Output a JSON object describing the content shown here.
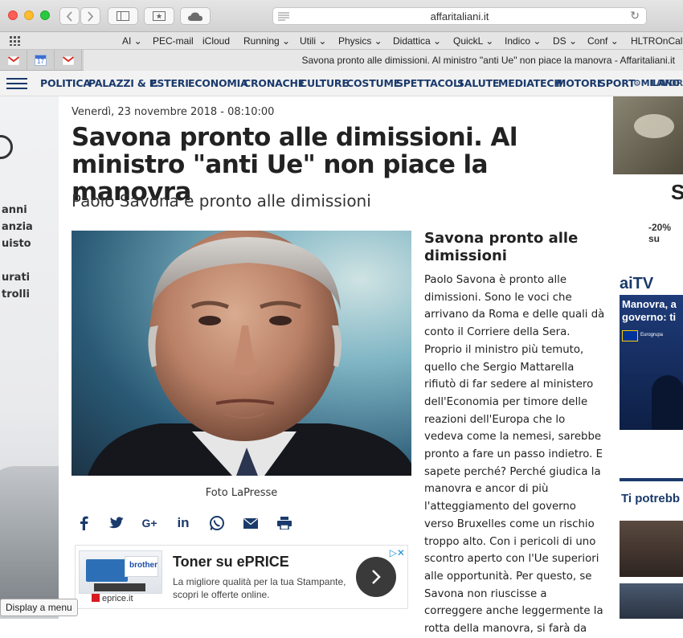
{
  "browser": {
    "url": "affaritaliani.it",
    "bookmarks": [
      "AI",
      "PEC-mail",
      "iCloud",
      "Running",
      "Utili",
      "Physics",
      "Didattica",
      "QuickL",
      "Indico",
      "DS",
      "Conf",
      "HLTROnCall_"
    ],
    "pinned_tabs": [
      "gmail-icon",
      "calendar-icon",
      "gmail-icon"
    ],
    "calendar_day": "17",
    "active_tab_title": "Savona pronto alle dimissioni. Al ministro \"anti Ue\" non piace la manovra - Affaritaliani.it"
  },
  "site_nav": {
    "items": [
      "POLITICA",
      "PALAZZI & P.",
      "ESTERI",
      "ECONOMIA",
      "CRONACHE",
      "CULTURE",
      "COSTUME",
      "SPETTACOLI",
      "SALUTE",
      "MEDIATECH",
      "MOTORI",
      "SPORT",
      "MILANO"
    ],
    "overflow": "LAVOR"
  },
  "left_ad": {
    "lines": [
      "anni",
      "anzia",
      "uisto",
      "urati",
      "trolli"
    ]
  },
  "article": {
    "date": "Venerdì, 23 novembre 2018 - 08:10:00",
    "headline": "Savona pronto alle dimissioni. Al ministro \"anti Ue\" non piace la manovra",
    "subtitle": "Paolo Savona è pronto alle dimissioni",
    "photo_caption": "Foto LaPresse",
    "side_title": "Savona pronto alle dimissioni",
    "body": "Paolo Savona è pronto alle dimissioni. Sono le voci che arrivano da Roma e delle quali dà conto il Corriere della Sera. Proprio il ministro più temuto, quello che Sergio Mattarella rifiutò di far sedere al ministero dell'Economia per timore delle reazioni dell'Europa che lo vedeva come la nemesi, sarebbe pronto a fare un passo indietro. E sapete perché? Perché giudica la manovra e ancor di più l'atteggiamento del governo verso Bruxelles come un rischio troppo alto. Con i pericoli di uno scontro aperto con l'Ue superiori alle opportunità. Per questo, se Savona non riuscisse a correggere anche leggermente la rotta della manovra, si farà da"
  },
  "social": [
    "facebook-icon",
    "twitter-icon",
    "google-plus-icon",
    "linkedin-icon",
    "whatsapp-icon",
    "email-icon",
    "print-icon"
  ],
  "ad": {
    "title": "Toner su ePRICE",
    "text": "La migliore qualità per la tua Stampante, scopri le offerte online.",
    "brand": "eprice.it",
    "printer_brand": "brother"
  },
  "right_column": {
    "price": "-20% su",
    "aitv": "aiTV",
    "video_title_1": "Manovra, a",
    "video_title_2": "governo: ti",
    "video_tag": "Eurogrupa",
    "recommend": "Ti potrebb"
  },
  "tooltip": "Display a menu"
}
